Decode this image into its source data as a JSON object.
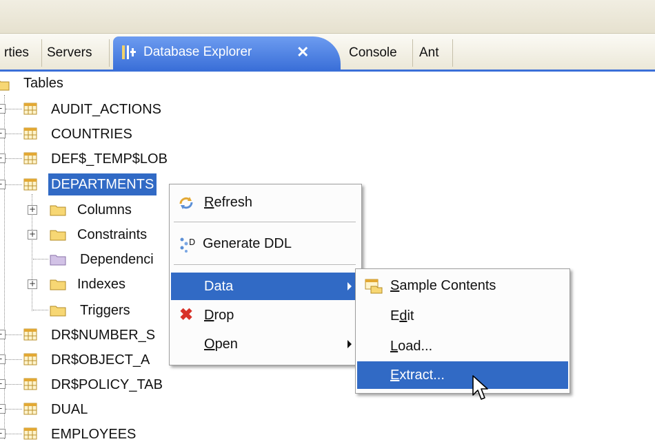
{
  "tabs": [
    {
      "label": "rties"
    },
    {
      "label": "Servers"
    },
    {
      "label": "Database Explorer",
      "active": true
    },
    {
      "label": "Console"
    },
    {
      "label": "Ant"
    }
  ],
  "tree": {
    "root": "Tables",
    "tables_before": [
      "AUDIT_ACTIONS",
      "COUNTRIES",
      "DEF$_TEMP$LOB"
    ],
    "selected": "DEPARTMENTS",
    "children": [
      "Columns",
      "Constraints",
      "Dependenci",
      "Indexes",
      "Triggers"
    ],
    "tables_after": [
      "DR$NUMBER_S",
      "DR$OBJECT_A",
      "DR$POLICY_TAB",
      "DUAL",
      "EMPLOYEES"
    ]
  },
  "context_menu": {
    "refresh": {
      "prefix": "",
      "mnemonic": "R",
      "rest": "efresh"
    },
    "generate_ddl": "Generate DDL",
    "data": "Data",
    "drop": {
      "prefix": "",
      "mnemonic": "D",
      "rest": "rop"
    },
    "open": {
      "prefix": "",
      "mnemonic": "O",
      "rest": "pen"
    }
  },
  "submenu": {
    "sample_contents": {
      "prefix": "",
      "mnemonic": "S",
      "rest": "ample Contents"
    },
    "edit": {
      "prefix": "E",
      "mnemonic": "d",
      "rest": "it"
    },
    "load": {
      "prefix": "",
      "mnemonic": "L",
      "rest": "oad..."
    },
    "extract": {
      "prefix": "",
      "mnemonic": "E",
      "rest": "xtract..."
    }
  },
  "colors": {
    "selection": "#316ac5",
    "tab_active": "#3a6fd8"
  }
}
